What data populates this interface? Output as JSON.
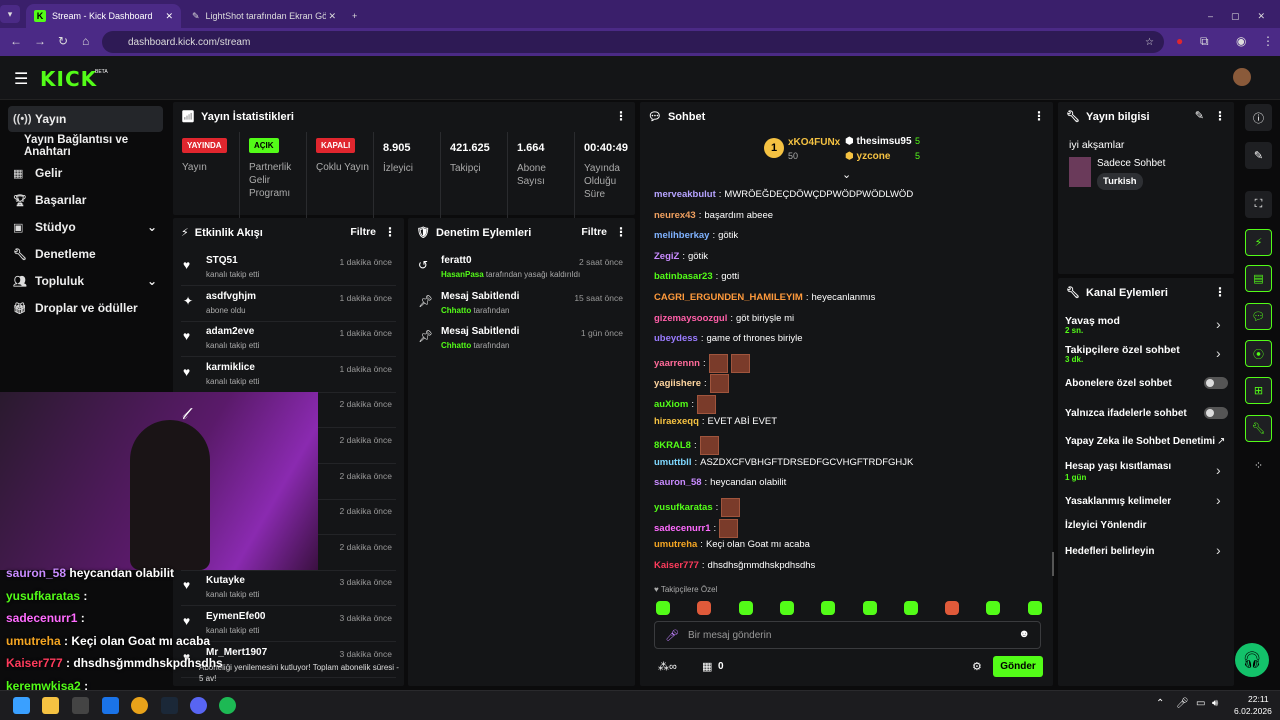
{
  "browser": {
    "tabs": [
      {
        "label": "Stream - Kick Dashboard"
      },
      {
        "label": "LightShot tarafından Ekran Gör"
      }
    ],
    "url": "dashboard.kick.com/stream"
  },
  "kick": {
    "logo": "KICK",
    "beta": "BETA"
  },
  "sidebar": {
    "items": [
      {
        "label": "Yayın",
        "icon": "broadcast-icon"
      },
      {
        "label": "Yayın Bağlantısı ve Anahtarı"
      },
      {
        "label": "Gelir",
        "icon": "revenue-icon"
      },
      {
        "label": "Başarılar",
        "icon": "trophy-icon"
      },
      {
        "label": "Stüdyo",
        "icon": "studio-icon"
      },
      {
        "label": "Denetleme",
        "icon": "wrench-icon"
      },
      {
        "label": "Topluluk",
        "icon": "community-icon"
      },
      {
        "label": "Droplar ve ödüller",
        "icon": "gift-icon"
      }
    ]
  },
  "stats": {
    "title": "Yayın İstatistikleri",
    "badges": [
      {
        "text": "YAYINDA",
        "label": "Yayın",
        "color": "#e0262e"
      },
      {
        "text": "AÇIK",
        "label": "Partnerlik Gelir Programı",
        "color": "#53fc18"
      },
      {
        "text": "KAPALI",
        "label": "Çoklu Yayın",
        "color": "#e0262e"
      }
    ],
    "values": [
      {
        "value": "8.905",
        "label": "İzleyici"
      },
      {
        "value": "421.625",
        "label": "Takipçi"
      },
      {
        "value": "1.664",
        "label": "Abone Sayısı"
      },
      {
        "value": "00:40:49",
        "label": "Yayında Olduğu Süre"
      }
    ]
  },
  "activity": {
    "title": "Etkinlik Akışı",
    "filter": "Filtre",
    "rows": [
      {
        "name": "STQ51",
        "sub": "kanalı takip etti",
        "time": "1 dakika önce"
      },
      {
        "name": "asdfvghjm",
        "sub": "abone oldu",
        "time": "1 dakika önce"
      },
      {
        "name": "adam2eve",
        "sub": "kanalı takip etti",
        "time": "1 dakika önce"
      },
      {
        "name": "karmiklice",
        "sub": "kanalı takip etti",
        "time": "1 dakika önce"
      },
      {
        "name": "",
        "sub": "",
        "time": "2 dakika önce"
      },
      {
        "name": "",
        "sub": "",
        "time": "2 dakika önce"
      },
      {
        "name": "",
        "sub": "",
        "time": "2 dakika önce"
      },
      {
        "name": "",
        "sub": "",
        "time": "2 dakika önce"
      },
      {
        "name": "",
        "sub": "",
        "time": "2 dakika önce"
      },
      {
        "name": "Kutayke",
        "sub": "kanalı takip etti",
        "time": "3 dakika önce"
      },
      {
        "name": "EymenEfe00",
        "sub": "kanalı takip etti",
        "time": "3 dakika önce"
      },
      {
        "name": "Mr_Mert1907",
        "sub": "",
        "time": "3 dakika önce"
      }
    ],
    "last_note": "Aboneliği yenilemesini kutluyor! Toplam abonelik süresi - 5 av!"
  },
  "moderation": {
    "title": "Denetim Eylemleri",
    "filter": "Filtre",
    "rows": [
      {
        "name": "feratt0",
        "by": "HasanPasa",
        "sub": "tarafından yasağı kaldırıldı",
        "time": "2 saat önce"
      },
      {
        "name": "Mesaj Sabitlendi",
        "by": "Chhatto",
        "sub": "tarafından",
        "time": "15 saat önce"
      },
      {
        "name": "Mesaj Sabitlendi",
        "by": "Chhatto",
        "sub": "tarafından",
        "time": "1 gün önce"
      }
    ]
  },
  "chat": {
    "title": "Sohbet",
    "top": [
      {
        "name": "xKO4FUNx",
        "count": "50",
        "color": "#f5c242"
      },
      {
        "name": "thesimsu95",
        "count": "5",
        "color": "#ffffff"
      },
      {
        "name": "yzcone",
        "count": "5",
        "color": "#f5c242"
      }
    ],
    "messages": [
      {
        "user": "merveakbulut",
        "color": "#b6a3ff",
        "text": "MWRÖEĞDEÇDÖWÇDPWÖDPWÖDLWÖD"
      },
      {
        "user": "neurex43",
        "color": "#f0a060",
        "text": "başardım abeee"
      },
      {
        "user": "melihberkay",
        "color": "#7fb2ff",
        "text": "götik"
      },
      {
        "user": "ZegiZ",
        "color": "#c98bff",
        "text": "götik"
      },
      {
        "user": "batinbasar23",
        "color": "#53fc18",
        "text": "gotti"
      },
      {
        "user": "CAGRI_ERGUNDEN_HAMILEYIM",
        "color": "#ff9a3c",
        "text": "heyecanlanmıs"
      },
      {
        "user": "gizemaysoozgul",
        "color": "#ff5fa8",
        "text": "göt biriyşle mi"
      },
      {
        "user": "ubeydess",
        "color": "#9a7bff",
        "text": "game of thrones biriyle"
      },
      {
        "user": "yaarrennn",
        "color": "#ff6b9a",
        "text": ""
      },
      {
        "user": "yagiishere",
        "color": "#ffd6a0",
        "text": ""
      },
      {
        "user": "auXiom",
        "color": "#53fc18",
        "text": ""
      },
      {
        "user": "hiraexeqq",
        "color": "#f5c242",
        "text": "EVET ABİ EVET"
      },
      {
        "user": "8KRAL8",
        "color": "#53fc18",
        "text": ""
      },
      {
        "user": "umuttbll",
        "color": "#7fd8ff",
        "text": "ASZDXCFVBHGFTDRSEDFGCVHGFTRDFGHJK"
      },
      {
        "user": "sauron_58",
        "color": "#c98bff",
        "text": "heycandan olabilit"
      },
      {
        "user": "yusufkaratas",
        "color": "#53fc18",
        "text": ""
      },
      {
        "user": "sadecenurr1",
        "color": "#ff6bff",
        "text": ""
      },
      {
        "user": "umutreha",
        "color": "#f5a623",
        "text": "Keçi olan Goat mı acaba"
      },
      {
        "user": "Kaiser777",
        "color": "#ff3b5c",
        "text": "dhsdhsğmmdhskpdhsdhs"
      }
    ],
    "followers_only": "Takipçilere Özel",
    "placeholder": "Bir mesaj gönderin",
    "bottom_count": "0",
    "send": "Gönder"
  },
  "streaminfo": {
    "title": "Yayın bilgisi",
    "stream_title": "iyi akşamlar",
    "category": "Sadece Sohbet",
    "tag": "Turkish"
  },
  "channel": {
    "title": "Kanal Eylemleri",
    "items": [
      {
        "label": "Yavaş mod",
        "sub": "2 sn."
      },
      {
        "label": "Takipçilere özel sohbet",
        "sub": "3 dk."
      },
      {
        "label": "Abonelere özel sohbet"
      },
      {
        "label": "Yalnızca ifadelerle sohbet"
      },
      {
        "label": "Yapay Zeka ile Sohbet Denetimi"
      },
      {
        "label": "Hesap yaşı kısıtlaması",
        "sub": "1 gün"
      },
      {
        "label": "Yasaklanmış kelimeler"
      },
      {
        "label": "İzleyici Yönlendir"
      },
      {
        "label": "Hedefleri belirleyin"
      }
    ]
  },
  "overlay": {
    "lines": [
      {
        "user": "sauron_58",
        "text": "heycandan olabilit",
        "color": "#c98bff"
      },
      {
        "user": "yusufkaratas",
        "text": ":",
        "color": "#53fc18"
      },
      {
        "user": "sadecenurr1",
        "text": ":",
        "color": "#ff6bff"
      },
      {
        "user": "umutreha",
        "text": ": Keçi olan Goat mı acaba",
        "color": "#f5a623"
      },
      {
        "user": "Kaiser777",
        "text": ": dhsdhsğmmdhskpdhsdhs",
        "color": "#ff3b5c"
      },
      {
        "user": "keremwkisa2",
        "text": ":",
        "color": "#53fc18"
      }
    ]
  },
  "taskbar": {
    "time": "22:11",
    "date": "6.02.2026"
  }
}
